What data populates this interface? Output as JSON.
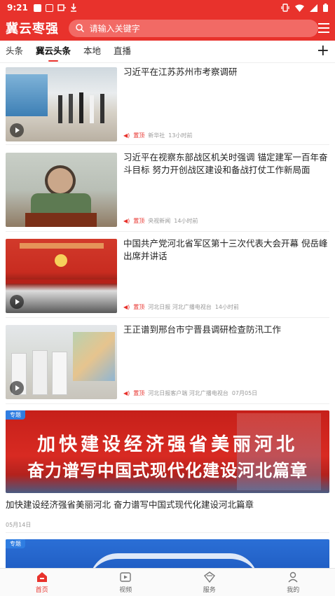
{
  "status_bar": {
    "time": "9:21",
    "left_icons": [
      "notification-box-icon",
      "a-icon",
      "battery-saver-icon",
      "download-icon"
    ],
    "right_icons": [
      "vibrate-icon",
      "wifi-icon",
      "signal-icon",
      "battery-icon"
    ]
  },
  "header": {
    "logo": "冀云枣强",
    "search_placeholder": "请输入关键字"
  },
  "tabs": [
    {
      "label": "头条",
      "active": false
    },
    {
      "label": "冀云头条",
      "active": true
    },
    {
      "label": "本地",
      "active": false
    },
    {
      "label": "直播",
      "active": false
    }
  ],
  "news": [
    {
      "title": "习近平在江苏苏州市考察调研",
      "pinned": "置顶",
      "source": "新华社",
      "time": "13小时前",
      "has_video": true
    },
    {
      "title": "习近平在视察东部战区机关时强调 锚定建军一百年奋斗目标 努力开创战区建设和备战打仗工作新局面",
      "pinned": "置顶",
      "source": "央视新闻",
      "time": "14小时前",
      "has_video": false
    },
    {
      "title": "中国共产党河北省军区第十三次代表大会开幕 倪岳峰出席并讲话",
      "pinned": "置顶",
      "source": "河北日报 河北广播电视台",
      "time": "14小时前",
      "has_video": true
    },
    {
      "title": "王正谱到邢台市宁晋县调研检查防汛工作",
      "pinned": "置顶",
      "source": "河北日报客户端 河北广播电视台",
      "time": "07月05日",
      "has_video": true
    }
  ],
  "feature": {
    "tag": "专题",
    "banner_line1": "加快建设经济强省美丽河北",
    "banner_line2": "奋力谱写中国式现代化建设河北篇章",
    "title": "加快建设经济强省美丽河北 奋力谱写中国式现代化建设河北篇章",
    "date": "05月14日"
  },
  "feature2": {
    "tag": "专题"
  },
  "bottom_nav": [
    {
      "label": "首页",
      "icon": "home-icon",
      "active": true
    },
    {
      "label": "视频",
      "icon": "video-icon",
      "active": false
    },
    {
      "label": "服务",
      "icon": "service-icon",
      "active": false
    },
    {
      "label": "我的",
      "icon": "profile-icon",
      "active": false
    }
  ],
  "colors": {
    "brand": "#e8322c",
    "tag_blue": "#2f7de1"
  }
}
